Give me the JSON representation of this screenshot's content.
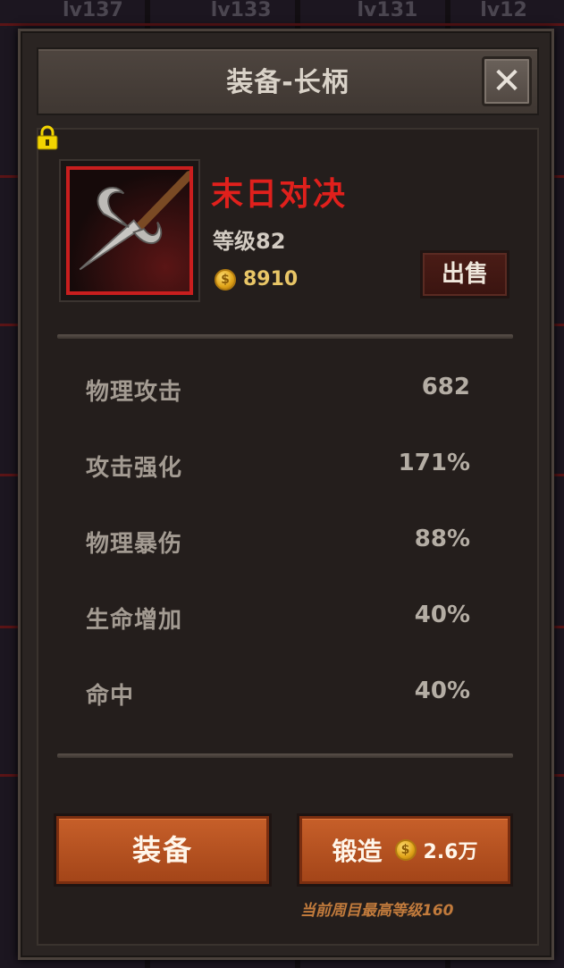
{
  "background": {
    "levels": [
      "lv137",
      "lv133",
      "lv131",
      "lv12"
    ]
  },
  "dialog": {
    "title": "装备-长柄",
    "close_label": "✕"
  },
  "item": {
    "name": "末日对决",
    "level": "等级82",
    "price": "8910",
    "sell_label": "出售",
    "locked": true,
    "rarity_color": "#c81e1e",
    "icon": "halberd-icon"
  },
  "stats": [
    {
      "label": "物理攻击",
      "value": "682"
    },
    {
      "label": "攻击强化",
      "value": "171%"
    },
    {
      "label": "物理暴伤",
      "value": "88%"
    },
    {
      "label": "生命增加",
      "value": "40%"
    },
    {
      "label": "命中",
      "value": "40%"
    }
  ],
  "actions": {
    "equip_label": "装备",
    "forge_label": "锻造",
    "forge_cost": "2.6万",
    "note": "当前周目最高等级160"
  },
  "colors": {
    "accent": "#c8602a",
    "item_name": "#e0201c",
    "gold": "#e9c667"
  }
}
